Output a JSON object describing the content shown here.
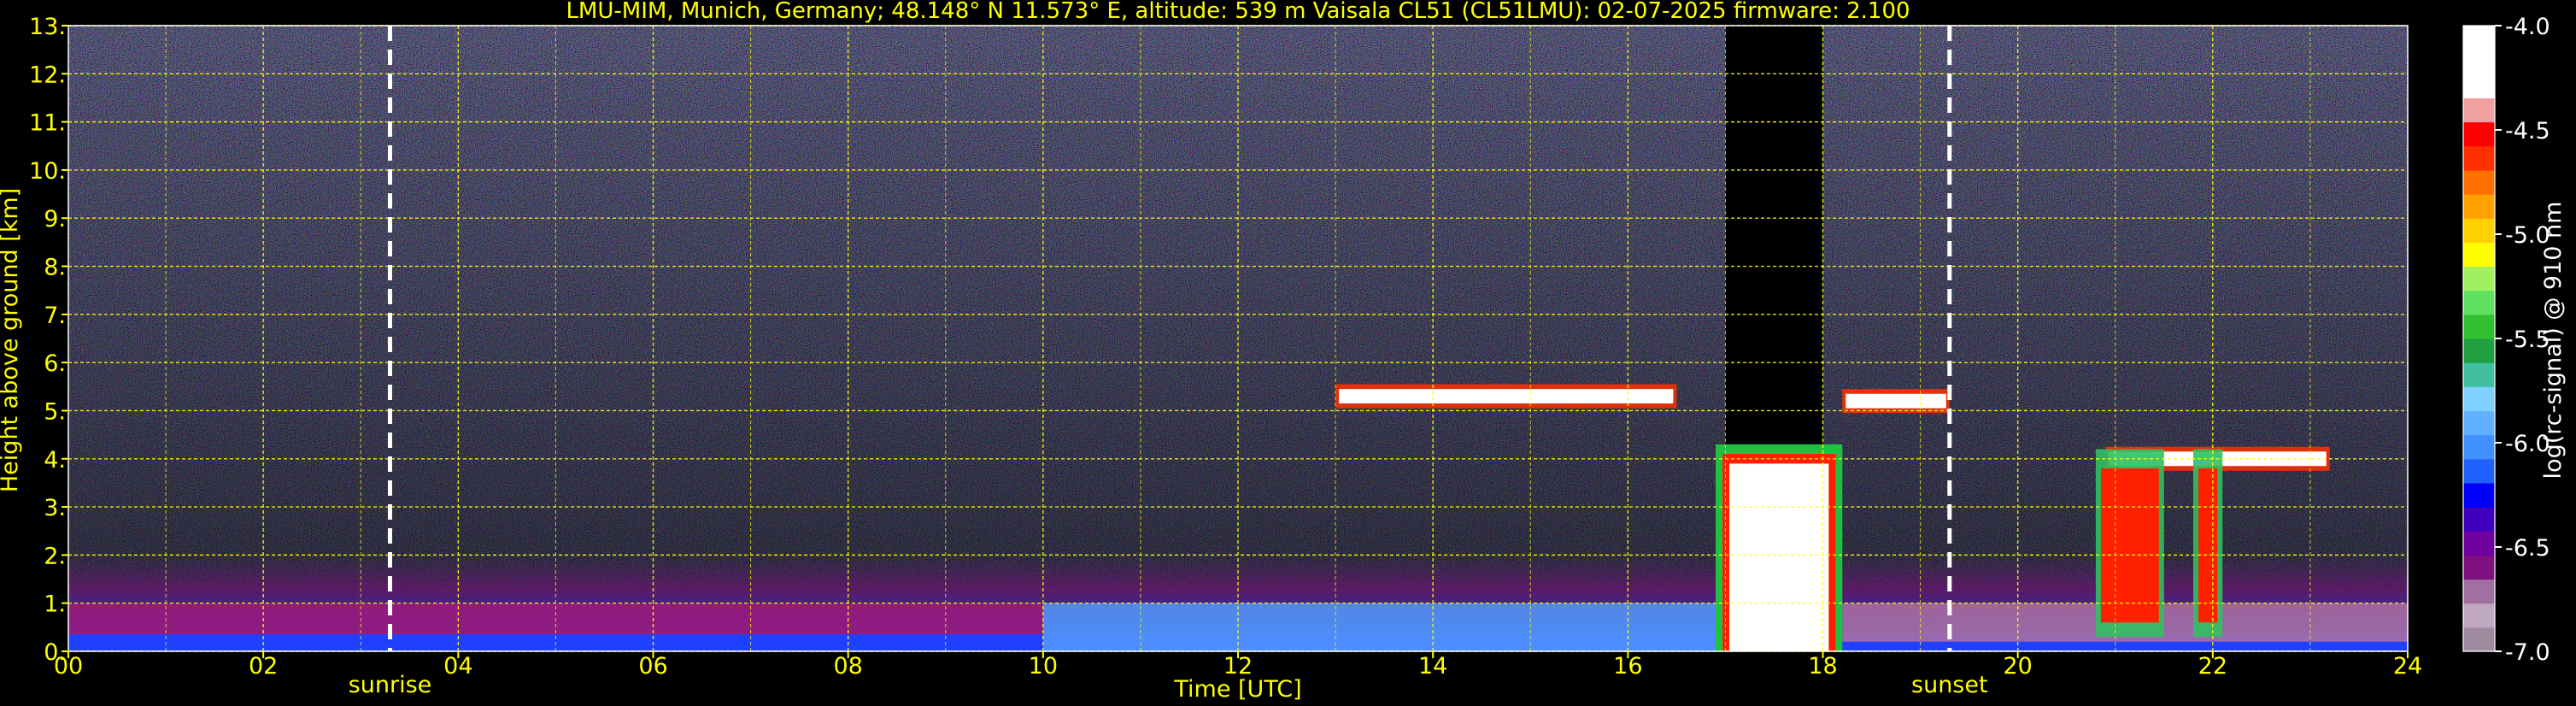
{
  "chart_data": {
    "type": "heatmap",
    "title": "LMU-MIM, Munich, Germany; 48.148° N 11.573° E, altitude: 539 m    Vaisala CL51 (CL51LMU): 02-07-2025    firmware: 2.100",
    "xlabel": "Time [UTC]",
    "ylabel": "Height above ground [km]",
    "xlim": [
      0,
      24
    ],
    "ylim": [
      0,
      13
    ],
    "x_ticks": [
      "00",
      "02",
      "04",
      "06",
      "08",
      "10",
      "12",
      "14",
      "16",
      "18",
      "20",
      "22",
      "24"
    ],
    "y_ticks": [
      "0.",
      "1.",
      "2.",
      "3.",
      "4.",
      "5.",
      "6.",
      "7.",
      "8.",
      "9.",
      "10.",
      "11.",
      "12.",
      "13."
    ],
    "grid": true,
    "markers": [
      {
        "label": "sunrise",
        "time": 3.3
      },
      {
        "label": "sunset",
        "time": 19.3
      }
    ],
    "colorbar": {
      "label": "log(rc-signal) @ 910 nm",
      "range": [
        -7.0,
        -4.0
      ],
      "ticks": [
        "-4.0",
        "-4.5",
        "-5.0",
        "-5.5",
        "-6.0",
        "-6.5",
        "-7.0"
      ],
      "colors": [
        "#a08aa0",
        "#c0a8c0",
        "#a070a0",
        "#801080",
        "#7000a0",
        "#4000c0",
        "#0000ff",
        "#2060ff",
        "#4090ff",
        "#60b0ff",
        "#80d0ff",
        "#40c0a0",
        "#20a040",
        "#30c030",
        "#60e060",
        "#a0f060",
        "#ffff00",
        "#ffd000",
        "#ffa000",
        "#ff7000",
        "#ff3000",
        "#ff0000",
        "#f0a0a0",
        "#ffffff",
        "#ffffff",
        "#ffffff"
      ]
    },
    "features": [
      {
        "name": "boundary layer aerosol",
        "t0": 0,
        "t1": 24,
        "h_top": 1.0
      },
      {
        "name": "cloud layer",
        "t0": 13.0,
        "t1": 16.5,
        "h": 5.3
      },
      {
        "name": "dense cloud / precipitation",
        "t0": 16.9,
        "t1": 18.2,
        "h_top": 4.3
      },
      {
        "name": "cloud layer",
        "t0": 18.2,
        "t1": 19.3,
        "h": 5.2
      },
      {
        "name": "cloud layer",
        "t0": 20.9,
        "t1": 23.2,
        "h": 4.0
      },
      {
        "name": "signal extinction",
        "t0": 17.0,
        "t1": 18.0,
        "h_top": 13.0
      }
    ]
  }
}
